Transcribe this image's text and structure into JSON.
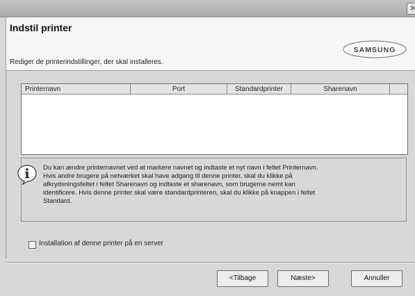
{
  "window": {
    "close_glyph": "✕"
  },
  "header": {
    "title": "Indstil printer",
    "subtitle": "Rediger de printerindstillinger, der skal installeres.",
    "logo_text": "SAMSUNG"
  },
  "printer_list": {
    "columns": [
      "Printernavn",
      "Port",
      "Standardprinter",
      "Sharenavn"
    ],
    "rows": []
  },
  "info": {
    "icon": "info-icon",
    "text_lines": [
      "Du kan ændre printernavnet ved at markere navnet og indtaste et nyt navn i feltet Printernavn.",
      "Hvis andre brugere på netværket skal have adgang til denne printer, skal du klikke på",
      "afkrydsningsfeltet i feltet Sharenavn og indtaste et sharenavn, som brugerne nemt kan",
      "identificere. Hvis denne printer skal være standardprinteren, skal du klikke på knappen i feltet",
      "Standard."
    ]
  },
  "server_option": {
    "label": "Installation af denne printer på en server",
    "checked": false
  },
  "buttons": {
    "back": "<Tilbage",
    "next": "Næste>",
    "cancel": "Annuller"
  }
}
